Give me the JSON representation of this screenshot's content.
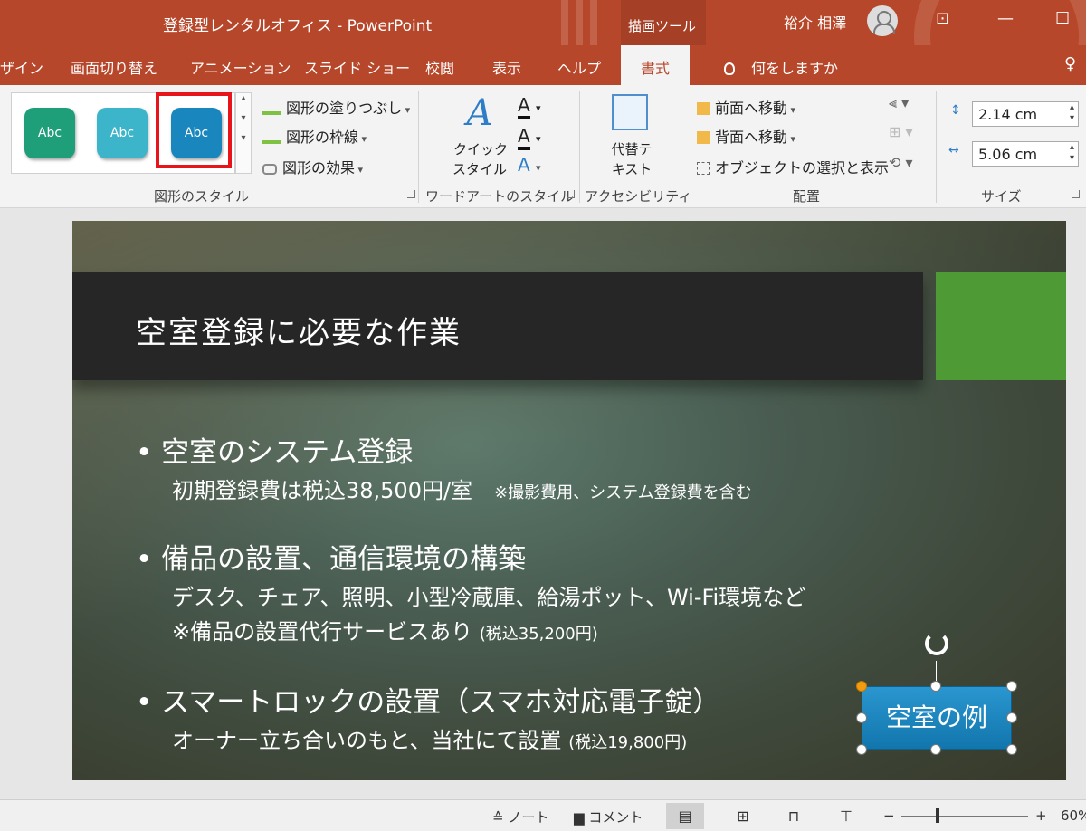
{
  "window": {
    "title": "登録型レンタルオフィス  -  PowerPoint",
    "context_tab_group": "描画ツール",
    "user_name": "裕介 相澤"
  },
  "tabs": [
    {
      "label": "ザイン"
    },
    {
      "label": "画面切り替え"
    },
    {
      "label": "アニメーション"
    },
    {
      "label": "スライド ショー"
    },
    {
      "label": "校閲"
    },
    {
      "label": "表示"
    },
    {
      "label": "ヘルプ"
    },
    {
      "label": "書式",
      "active": true
    }
  ],
  "tell_me": "何をしますか",
  "ribbon": {
    "shape_styles": {
      "group_label": "図形のスタイル",
      "swatches": [
        {
          "label": "Abc",
          "color": "#1f9e7a"
        },
        {
          "label": "Abc",
          "color": "#3cb4c9"
        },
        {
          "label": "Abc",
          "color": "#1a86be",
          "selected": true
        }
      ],
      "fill": "図形の塗りつぶし",
      "outline": "図形の枠線",
      "effects": "図形の効果"
    },
    "wordart": {
      "group_label": "ワードアートのスタイル",
      "quick_style_line1": "クイック",
      "quick_style_line2": "スタイル"
    },
    "accessibility": {
      "group_label": "アクセシビリティ",
      "alt_text_line1": "代替テ",
      "alt_text_line2": "キスト"
    },
    "arrange": {
      "group_label": "配置",
      "bring_forward": "前面へ移動",
      "send_backward": "背面へ移動",
      "selection_pane": "オブジェクトの選択と表示"
    },
    "size": {
      "group_label": "サイズ",
      "height": "2.14 cm",
      "width": "5.06 cm"
    }
  },
  "slide": {
    "title": "空室登録に必要な作業",
    "bullets": [
      {
        "text": "• 空室のシステム登録"
      },
      {
        "text": "• 備品の設置、通信環境の構築"
      },
      {
        "text": "• スマートロックの設置（スマホ対応電子錠）"
      }
    ],
    "sub_lines": [
      {
        "text": "初期登録費は税込38,500円/室",
        "note": "※撮影費用、システム登録費を含む"
      },
      {
        "text": "デスク、チェア、照明、小型冷蔵庫、給湯ポット、Wi-Fi環境など",
        "note": ""
      },
      {
        "text": "※備品の設置代行サービスあり",
        "note": "(税込35,200円)"
      },
      {
        "text": "オーナー立ち合いのもと、当社にて設置",
        "note": "(税込19,800円)"
      }
    ],
    "selected_shape_text": "空室の例"
  },
  "status_bar": {
    "notes": "ノート",
    "comments": "コメント",
    "zoom": "60%"
  }
}
